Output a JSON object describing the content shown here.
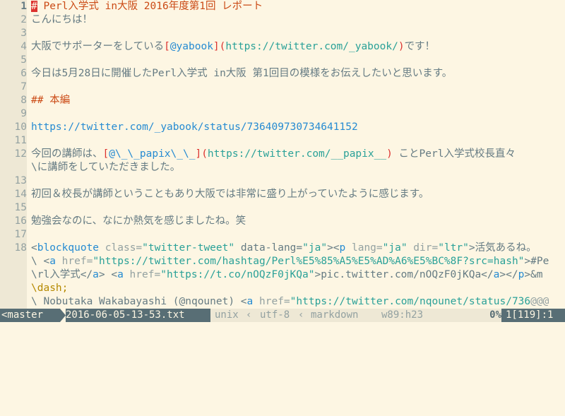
{
  "editor": {
    "lines": [
      {
        "num": "1",
        "parts": [
          {
            "t": "#",
            "c": "cursor"
          },
          {
            "t": " Perl入学式 in大阪 2016年度第1回 レポート",
            "c": "hd"
          }
        ]
      },
      {
        "num": "2",
        "parts": [
          {
            "t": "こんにちは！",
            "c": ""
          }
        ]
      },
      {
        "num": "3",
        "parts": []
      },
      {
        "num": "4",
        "parts": [
          {
            "t": "大阪でサポーターをしている",
            "c": ""
          },
          {
            "t": "[",
            "c": "br"
          },
          {
            "t": "@yabook",
            "c": "link"
          },
          {
            "t": "]",
            "c": "br"
          },
          {
            "t": "(",
            "c": "br"
          },
          {
            "t": "https://twitter.com/_yabook/",
            "c": "url"
          },
          {
            "t": ")",
            "c": "br"
          },
          {
            "t": "です！",
            "c": ""
          }
        ]
      },
      {
        "num": "5",
        "parts": []
      },
      {
        "num": "6",
        "parts": [
          {
            "t": "今日は5月28日に開催したPerl入学式 in大阪 第1回目の模様をお伝えしたいと思います。",
            "c": ""
          }
        ]
      },
      {
        "num": "7",
        "parts": []
      },
      {
        "num": "8",
        "parts": [
          {
            "t": "## 本編",
            "c": "hd"
          }
        ]
      },
      {
        "num": "9",
        "parts": []
      },
      {
        "num": "10",
        "parts": [
          {
            "t": "https://twitter.com/_yabook/status/736409730734641152",
            "c": "link"
          }
        ]
      },
      {
        "num": "11",
        "parts": []
      },
      {
        "num": "12",
        "parts": [
          {
            "t": "今回の講師は、",
            "c": ""
          },
          {
            "t": "[",
            "c": "br"
          },
          {
            "t": "@\\_\\_papix\\_\\_",
            "c": "link"
          },
          {
            "t": "]",
            "c": "br"
          },
          {
            "t": "(",
            "c": "br"
          },
          {
            "t": "https://twitter.com/__papix__",
            "c": "url"
          },
          {
            "t": ")",
            "c": "br"
          },
          {
            "t": " ことPerl入学式校長直々",
            "c": ""
          }
        ]
      },
      {
        "num": "",
        "parts": [
          {
            "t": "\\に講師をしていただきました。",
            "c": "cont"
          }
        ]
      },
      {
        "num": "13",
        "parts": []
      },
      {
        "num": "14",
        "parts": [
          {
            "t": "初回＆校長が講師ということもあり大阪では非常に盛り上がっていたように感じます。",
            "c": ""
          }
        ]
      },
      {
        "num": "15",
        "parts": []
      },
      {
        "num": "16",
        "parts": [
          {
            "t": "勉強会なのに、なにか熱気を感じましたね。笑",
            "c": ""
          }
        ]
      },
      {
        "num": "17",
        "parts": []
      },
      {
        "num": "18",
        "parts": [
          {
            "t": "<",
            "c": ""
          },
          {
            "t": "blockquote",
            "c": "tag"
          },
          {
            "t": " class=",
            "c": "attr"
          },
          {
            "t": "\"twitter-tweet\"",
            "c": "str"
          },
          {
            "t": " data-lang=",
            "c": ""
          },
          {
            "t": "\"ja\"",
            "c": "str"
          },
          {
            "t": "><",
            "c": ""
          },
          {
            "t": "p",
            "c": "tag"
          },
          {
            "t": " lang=",
            "c": "attr"
          },
          {
            "t": "\"ja\"",
            "c": "str"
          },
          {
            "t": " dir=",
            "c": "attr"
          },
          {
            "t": "\"ltr\"",
            "c": "str"
          },
          {
            "t": ">活気あるね。",
            "c": ""
          }
        ]
      },
      {
        "num": "",
        "parts": [
          {
            "t": "\\ <",
            "c": ""
          },
          {
            "t": "a",
            "c": "tag"
          },
          {
            "t": " href=",
            "c": "attr"
          },
          {
            "t": "\"https://twitter.com/hashtag/Perl%E5%85%A5%E5%AD%A6%E5%BC%8F?src=hash\"",
            "c": "str"
          },
          {
            "t": ">#Pe",
            "c": ""
          }
        ]
      },
      {
        "num": "",
        "parts": [
          {
            "t": "\\rl入学式</",
            "c": ""
          },
          {
            "t": "a",
            "c": "tag"
          },
          {
            "t": "> <",
            "c": ""
          },
          {
            "t": "a",
            "c": "tag"
          },
          {
            "t": " href=",
            "c": "attr"
          },
          {
            "t": "\"https://t.co/nOQzF0jKQa\"",
            "c": "str"
          },
          {
            "t": ">pic.twitter.com/nOQzF0jKQa</",
            "c": ""
          },
          {
            "t": "a",
            "c": "tag"
          },
          {
            "t": "></",
            "c": ""
          },
          {
            "t": "p",
            "c": "tag"
          },
          {
            "t": ">&m",
            "c": ""
          }
        ]
      },
      {
        "num": "",
        "parts": [
          {
            "t": "\\dash;",
            "c": "esc"
          }
        ]
      },
      {
        "num": "",
        "parts": [
          {
            "t": "\\ Nobutaka Wakabayashi (@nqounet) <",
            "c": ""
          },
          {
            "t": "a",
            "c": "tag"
          },
          {
            "t": " href=",
            "c": "attr"
          },
          {
            "t": "\"https://twitter.com/nqounet/status/736",
            "c": "str"
          },
          {
            "t": "@@@",
            "c": "attr"
          }
        ]
      }
    ]
  },
  "statusbar": {
    "branch": "<master",
    "file": "2016-06-05-13-53.txt",
    "fileformat": "unix",
    "encoding": "utf-8",
    "filetype": "markdown",
    "window": "w89:h23",
    "percent": "0%",
    "position": "1[119]:1"
  }
}
